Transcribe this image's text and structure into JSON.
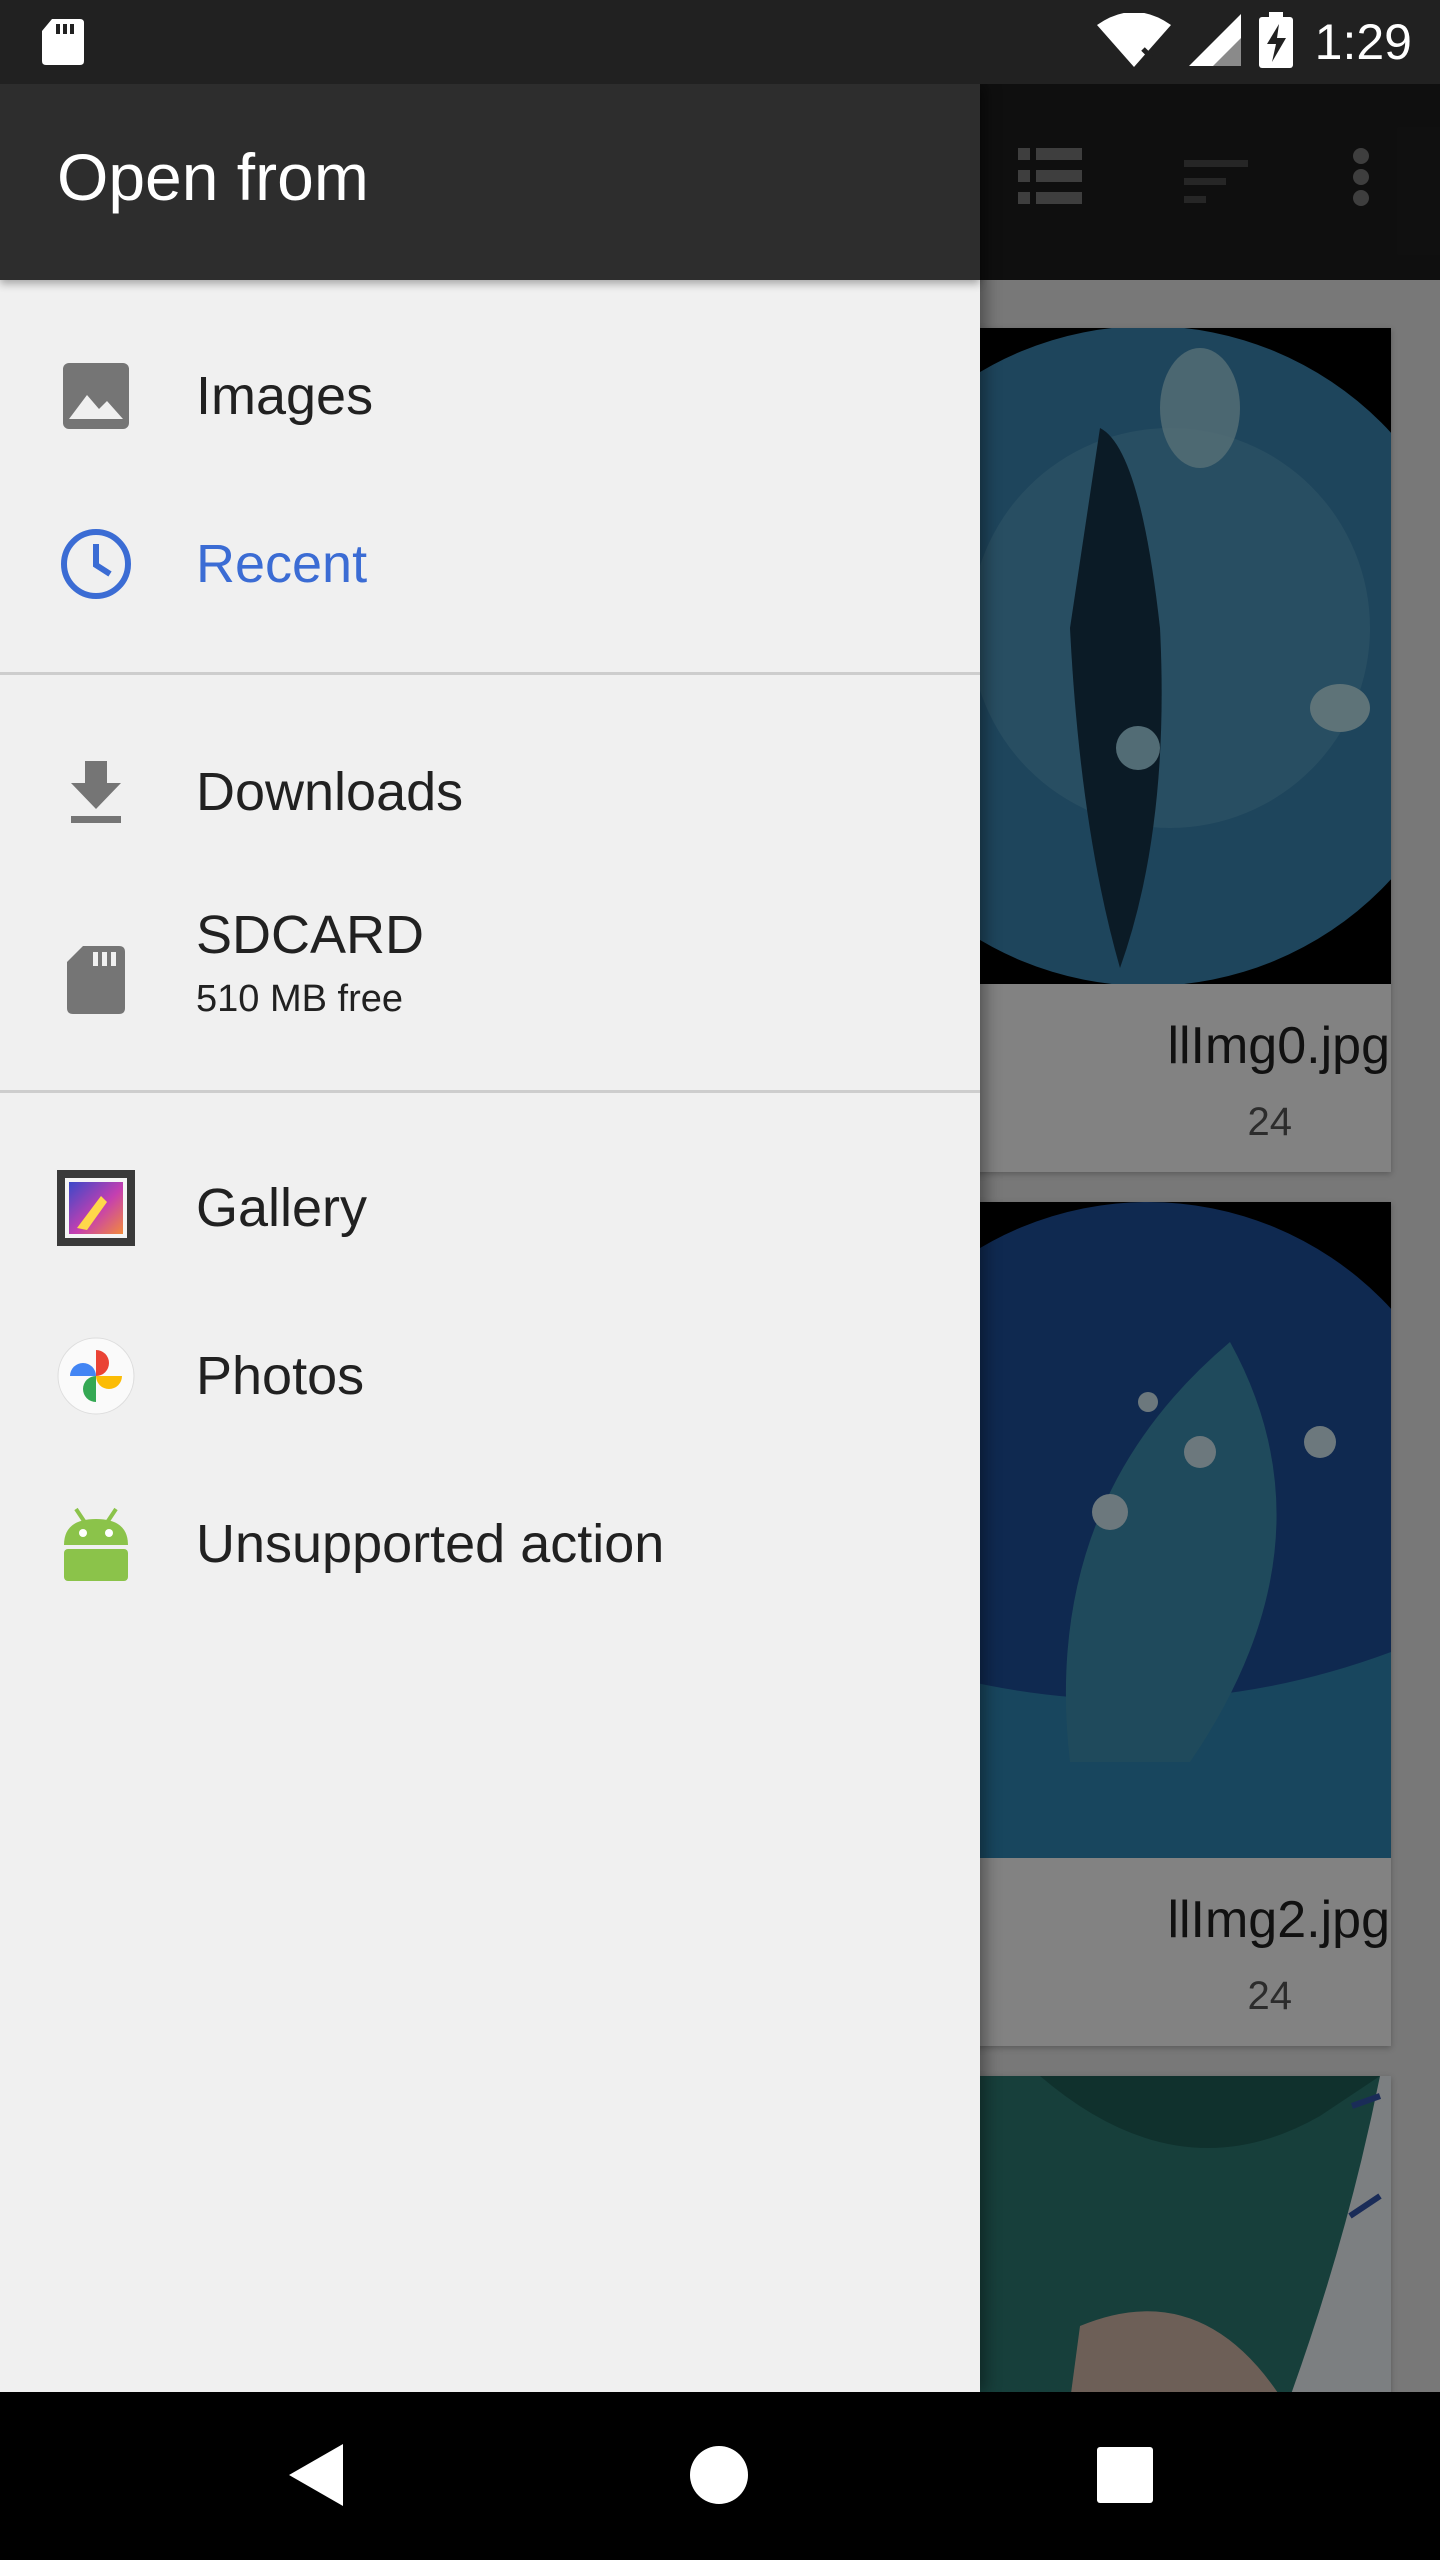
{
  "status_bar": {
    "time": "1:29"
  },
  "drawer": {
    "title": "Open from",
    "roots": [
      {
        "label": "Images",
        "icon": "image-icon",
        "selected": false
      },
      {
        "label": "Recent",
        "icon": "clock-icon",
        "selected": true
      },
      {
        "label": "Downloads",
        "icon": "download-icon",
        "selected": false
      },
      {
        "label": "SDCARD",
        "summary": "510 MB free",
        "icon": "sd-card-icon",
        "selected": false
      },
      {
        "label": "Gallery",
        "icon": "gallery-app-icon",
        "selected": false
      },
      {
        "label": "Photos",
        "icon": "photos-app-icon",
        "selected": false
      },
      {
        "label": "Unsupported action",
        "icon": "android-icon",
        "selected": false
      }
    ]
  },
  "files": [
    {
      "name": "llImg0.jpg",
      "date": "24"
    },
    {
      "name": "llImg2.jpg",
      "date": "24"
    }
  ],
  "colors": {
    "accent": "#3b6cd4",
    "drawer_background": "#f0f0f0",
    "drawer_header": "#2d2d2d",
    "android_green": "#8bc34a"
  }
}
